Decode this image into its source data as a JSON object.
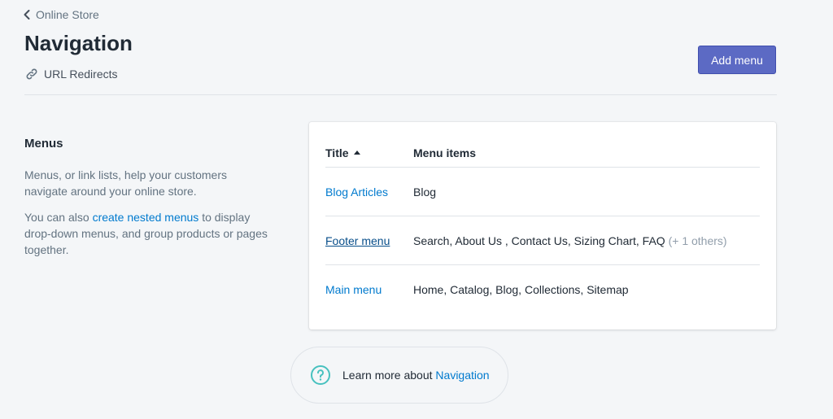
{
  "breadcrumb": {
    "label": "Online Store"
  },
  "page": {
    "title": "Navigation",
    "secondary_action": "URL Redirects",
    "primary_action": "Add menu"
  },
  "section": {
    "title": "Menus",
    "desc1": "Menus, or link lists, help your customers navigate around your online store.",
    "desc2_prefix": "You can also ",
    "desc2_link": "create nested menus",
    "desc2_suffix": " to display drop-down menus, and group products or pages together."
  },
  "table": {
    "headers": {
      "title": "Title",
      "items": "Menu items"
    },
    "rows": [
      {
        "title": "Blog Articles",
        "items": "Blog",
        "extra": ""
      },
      {
        "title": "Footer menu",
        "items": "Search, About Us , Contact Us, Sizing Chart, FAQ",
        "extra": "(+ 1 others)"
      },
      {
        "title": "Main menu",
        "items": "Home, Catalog, Blog, Collections, Sitemap",
        "extra": ""
      }
    ]
  },
  "learn_more": {
    "prefix": "Learn more about ",
    "link": "Navigation"
  },
  "colors": {
    "primary": "#5c6ac4",
    "link": "#007ace",
    "help_icon": "#47c1bf",
    "background": "#f4f6f8"
  },
  "icons": {
    "back": "chevron-left-icon",
    "redirect": "link-icon",
    "help": "question-circle-icon",
    "sort": "sort-ascending-icon"
  }
}
